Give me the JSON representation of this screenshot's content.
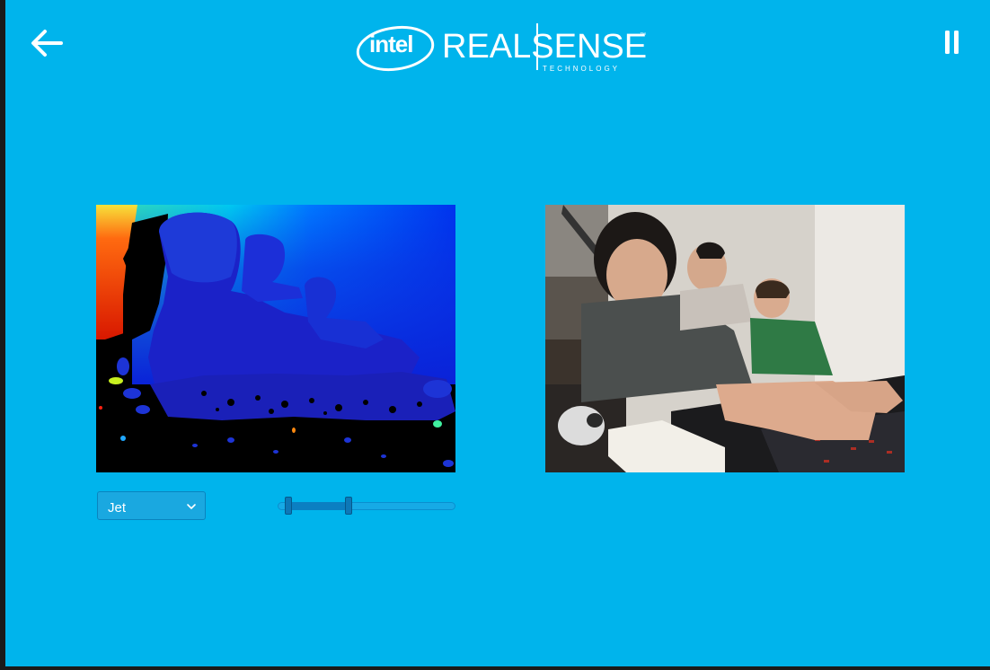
{
  "header": {
    "back_icon": "arrow-left-icon",
    "pause_icon": "pause-icon",
    "logo": {
      "intel": "intel",
      "product": "REALSENSE",
      "tm": "™",
      "subtitle": "TECHNOLOGY"
    }
  },
  "views": {
    "depth": {
      "content": "depth-stream-image",
      "colormap": "jet"
    },
    "color": {
      "content": "rgb-camera-stream-image"
    }
  },
  "controls": {
    "colormap": {
      "selected": "Jet",
      "icon": "chevron-down-icon"
    },
    "depth_range": {
      "low": 0.06,
      "high": 0.4
    }
  },
  "colors": {
    "background": "#00b4ec",
    "accent": "#0b7fc2",
    "text": "#ffffff"
  }
}
